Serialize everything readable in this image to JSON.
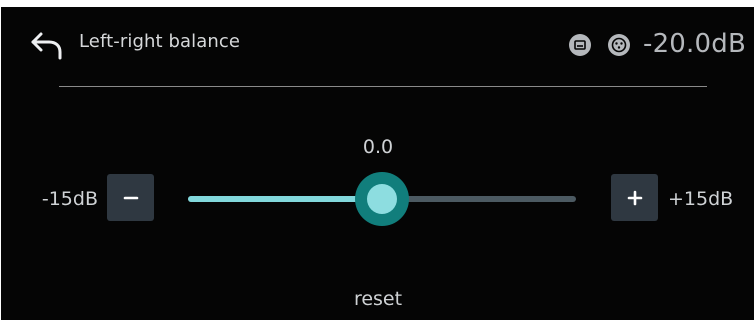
{
  "header": {
    "title": "Left-right balance",
    "status_icons": [
      "input-icon",
      "xlr-connector-icon"
    ],
    "level": "-20.0dB"
  },
  "balance": {
    "value": "0.0",
    "min_label": "-15dB",
    "max_label": "+15dB",
    "position_fraction": 0.5,
    "decrement_symbol": "−",
    "increment_symbol": "+"
  },
  "footer": {
    "reset_label": "reset"
  },
  "colors": {
    "background": "#050505",
    "accent": "#82d8dc",
    "thumb_ring": "#117e7c",
    "track": "#4c5a62",
    "button": "#2f3841"
  }
}
